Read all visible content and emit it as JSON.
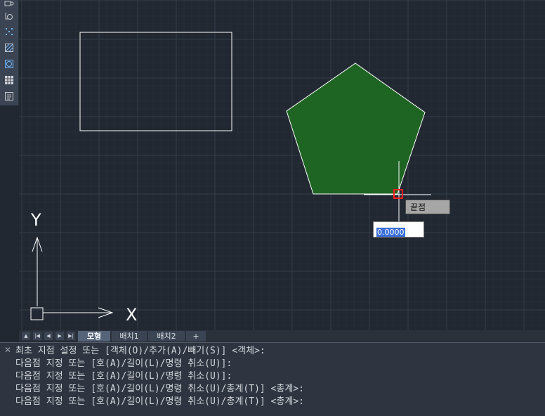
{
  "toolbar": {
    "tools": [
      {
        "icon": "block-icon"
      },
      {
        "icon": "copy-rotate-icon"
      },
      {
        "icon": "point-grid-icon"
      },
      {
        "icon": "hatch-icon"
      },
      {
        "icon": "region-icon"
      },
      {
        "icon": "table-icon"
      },
      {
        "icon": "text-block-icon"
      }
    ]
  },
  "drawing": {
    "ucs_x_label": "X",
    "ucs_y_label": "Y",
    "pentagon_fill": "#1e6423",
    "line_color": "#ffffff"
  },
  "snap": {
    "tooltip": "끝점",
    "input_value": "0.0000"
  },
  "tabs": {
    "nav": [
      "▲",
      "|◀",
      "◀",
      "▶",
      "▶|"
    ],
    "items": [
      "모형",
      "배치1",
      "배치2"
    ],
    "add_label": "+",
    "active_index": 0
  },
  "command": {
    "close_label": "✕",
    "lines": [
      "최초 지점 설정 또는 [객체(O)/추가(A)/빼기(S)] <객체>:",
      "다음점 지정 또는 [호(A)/길이(L)/명령 취소(U)]:",
      "다음점 지정 또는 [호(A)/길이(L)/명령 취소(U)]:",
      "다음점 지정 또는 [호(A)/길이(L)/명령 취소(U)/총계(T)] <총계>:",
      "다음점 지정 또는 [호(A)/길이(L)/명령 취소(U)/총계(T)] <총계>:"
    ]
  }
}
